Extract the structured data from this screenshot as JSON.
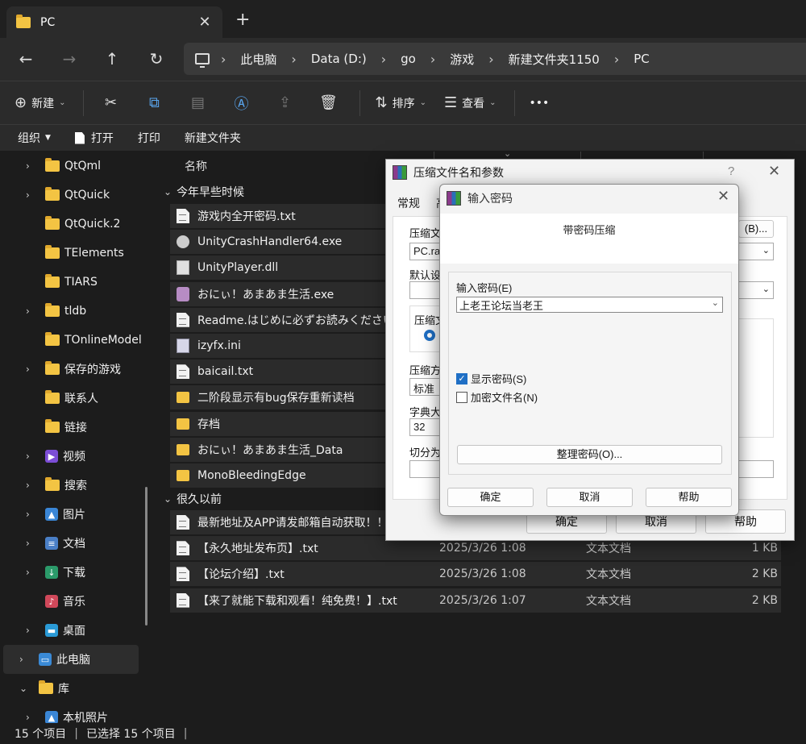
{
  "tab": {
    "title": "PC"
  },
  "address": {
    "crumbs": [
      "此电脑",
      "Data (D:)",
      "go",
      "游戏",
      "新建文件夹1150",
      "PC"
    ]
  },
  "toolbar": {
    "new_label": "新建",
    "sort_label": "排序",
    "view_label": "查看",
    "more_label": "•••"
  },
  "menu": {
    "organize": "组织",
    "open": "打开",
    "print": "打印",
    "new_folder": "新建文件夹"
  },
  "sidebar": {
    "items": [
      {
        "label": "QtQml",
        "chev": true,
        "icon": "folder"
      },
      {
        "label": "QtQuick",
        "chev": true,
        "icon": "folder"
      },
      {
        "label": "QtQuick.2",
        "chev": false,
        "icon": "folder"
      },
      {
        "label": "TElements",
        "chev": false,
        "icon": "folder"
      },
      {
        "label": "TIARS",
        "chev": false,
        "icon": "folder"
      },
      {
        "label": "tldb",
        "chev": true,
        "icon": "folder"
      },
      {
        "label": "TOnlineModel",
        "chev": false,
        "icon": "folder"
      },
      {
        "label": "保存的游戏",
        "chev": true,
        "icon": "folder"
      },
      {
        "label": "联系人",
        "chev": false,
        "icon": "folder"
      },
      {
        "label": "链接",
        "chev": false,
        "icon": "folder"
      },
      {
        "label": "视频",
        "chev": true,
        "icon": "video"
      },
      {
        "label": "搜索",
        "chev": true,
        "icon": "folder"
      },
      {
        "label": "图片",
        "chev": true,
        "icon": "picture"
      },
      {
        "label": "文档",
        "chev": true,
        "icon": "document"
      },
      {
        "label": "下载",
        "chev": true,
        "icon": "download"
      },
      {
        "label": "音乐",
        "chev": false,
        "icon": "music"
      },
      {
        "label": "桌面",
        "chev": true,
        "icon": "desktop"
      },
      {
        "label": "此电脑",
        "chev": true,
        "icon": "pc"
      },
      {
        "label": "库",
        "chev": true,
        "icon": "folder"
      },
      {
        "label": "本机照片",
        "chev": true,
        "icon": "picture"
      }
    ]
  },
  "filelist": {
    "column_name": "名称",
    "group_recent": "今年早些时候",
    "group_old": "很久以前",
    "recent": [
      {
        "name": "游戏内全开密码.txt",
        "icon": "txt"
      },
      {
        "name": "UnityCrashHandler64.exe",
        "icon": "exe"
      },
      {
        "name": "UnityPlayer.dll",
        "icon": "dll"
      },
      {
        "name": "おにぃ！あまあま生活.exe",
        "icon": "pic"
      },
      {
        "name": "Readme.はじめに必ずお読みください.t",
        "icon": "txt"
      },
      {
        "name": "izyfx.ini",
        "icon": "ini"
      },
      {
        "name": "baicail.txt",
        "icon": "txt"
      },
      {
        "name": "二阶段显示有bug保存重新读档",
        "icon": "fold"
      },
      {
        "name": "存档",
        "icon": "fold"
      },
      {
        "name": "おにぃ！あまあま生活_Data",
        "icon": "fold"
      },
      {
        "name": "MonoBleedingEdge",
        "icon": "fold"
      }
    ],
    "old": [
      {
        "name": "最新地址及APP请发邮箱自动获取！！",
        "date": "",
        "type": "",
        "size": "",
        "icon": "txt"
      },
      {
        "name": "【永久地址发布页】.txt",
        "date": "2025/3/26 1:08",
        "type": "文本文档",
        "size": "1 KB",
        "icon": "txt"
      },
      {
        "name": "【论坛介绍】.txt",
        "date": "2025/3/26 1:08",
        "type": "文本文档",
        "size": "2 KB",
        "icon": "txt"
      },
      {
        "name": "【来了就能下载和观看！纯免费！】.txt",
        "date": "2025/3/26 1:07",
        "type": "文本文档",
        "size": "2 KB",
        "icon": "txt"
      }
    ]
  },
  "status": {
    "count": "15 个项目",
    "selected": "已选择 15 个项目"
  },
  "archive_dialog": {
    "title": "压缩文件名和参数",
    "help_mark": "?",
    "tab_general": "常规",
    "tab_second": "高",
    "label_archive": "压缩文",
    "archive_name": "PC.rar",
    "browse_label": "(B)...",
    "label_default": "默认设置",
    "label_format": "压缩文",
    "label_method": "压缩方",
    "method_value": "标准",
    "label_dict": "字典大小",
    "dict_value": "32",
    "label_split": "切分为分",
    "ok": "确定",
    "cancel": "取消",
    "help": "帮助"
  },
  "password_dialog": {
    "title": "输入密码",
    "heading": "带密码压缩",
    "label": "输入密码(E)",
    "password": "上老王论坛当老王",
    "show_password": "显示密码(S)",
    "show_password_checked": true,
    "encrypt_names": "加密文件名(N)",
    "encrypt_names_checked": false,
    "organize": "整理密码(O)...",
    "ok": "确定",
    "cancel": "取消",
    "help": "帮助"
  }
}
